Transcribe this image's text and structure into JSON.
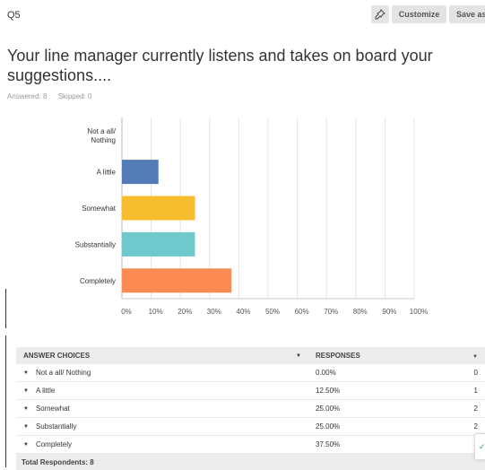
{
  "header": {
    "question_number": "Q5",
    "pin_icon": "pin-icon",
    "customize_label": "Customize",
    "save_label": "Save as"
  },
  "question": {
    "title": "Your line manager currently listens and takes on board your suggestions....",
    "answered": "Answered: 8",
    "skipped": "Skipped: 0"
  },
  "chart_data": {
    "type": "bar",
    "orientation": "horizontal",
    "categories": [
      "Not a all/ Nothing",
      "A little",
      "Somewhat",
      "Substantially",
      "Completely"
    ],
    "values": [
      0,
      12.5,
      25,
      25,
      37.5
    ],
    "colors": [
      "#537bb5",
      "#537bb5",
      "#f6be2f",
      "#6fc8cb",
      "#fb8a53"
    ],
    "xlim": [
      0,
      100
    ],
    "xticks": [
      "0%",
      "10%",
      "20%",
      "30%",
      "40%",
      "50%",
      "60%",
      "70%",
      "80%",
      "90%",
      "100%"
    ],
    "grid": true
  },
  "table": {
    "headers": {
      "choices": "ANSWER CHOICES",
      "responses": "RESPONSES"
    },
    "rows": [
      {
        "label": "Not a all/ Nothing",
        "percent": "0.00%",
        "count": "0"
      },
      {
        "label": "A little",
        "percent": "12.50%",
        "count": "1"
      },
      {
        "label": "Somewhat",
        "percent": "25.00%",
        "count": "2"
      },
      {
        "label": "Substantially",
        "percent": "25.00%",
        "count": "2"
      },
      {
        "label": "Completely",
        "percent": "37.50%",
        "count": "3"
      }
    ],
    "total": "Total Respondents: 8"
  }
}
